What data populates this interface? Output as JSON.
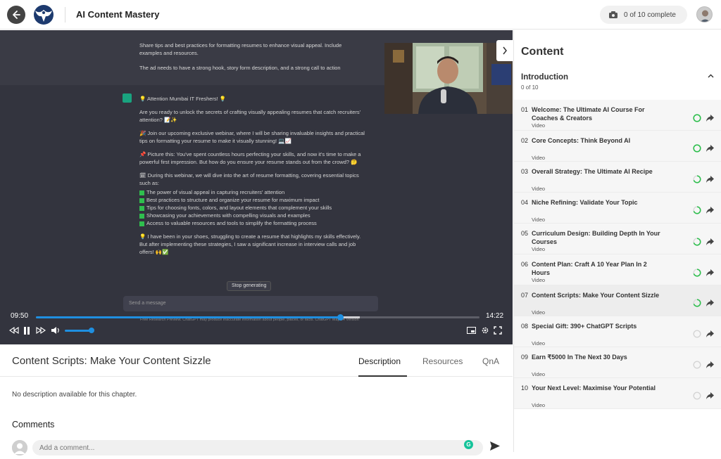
{
  "header": {
    "title": "AI Content Mastery",
    "progress_text": "0 of 10 complete"
  },
  "video": {
    "prompt_lines": [
      "Share tips and best practices for formatting resumes to enhance visual appeal. Include examples and resources.",
      "The ad needs to have a strong hook, story form description, and a strong call to action"
    ],
    "answer": {
      "p1": "💡 Attention Mumbai IT Freshers! 💡",
      "p2": "Are you ready to unlock the secrets of crafting visually appealing resumes that catch recruiters' attention? 📝✨",
      "p3": "🎉 Join our upcoming exclusive webinar, where I will be sharing invaluable insights and practical tips on formatting your resume to make it visually stunning! 💻📈",
      "p4": "📌 Picture this: You've spent countless hours perfecting your skills, and now it's time to make a powerful first impression. But how do you ensure your resume stands out from the crowd? 🤔",
      "p5": "🗓 During this webinar, we will dive into the art of resume formatting, covering essential topics such as:",
      "bullets": [
        "The power of visual appeal in capturing recruiters' attention",
        "Best practices to structure and organize your resume for maximum impact",
        "Tips for choosing fonts, colors, and layout elements that complement your skills",
        "Showcasing your achievements with compelling visuals and examples",
        "Access to valuable resources and tools to simplify the formatting process"
      ],
      "p6": "💡 I have been in your shoes, struggling to create a resume that highlights my skills effectively. But after implementing these strategies, I saw a significant increase in interview calls and job offers! 🙌✅"
    },
    "stop_generating": "Stop generating",
    "send_placeholder": "Send a message",
    "disclaimer": "Free Research Preview. ChatGPT may produce inaccurate information about people, places, or facts. ChatGPT May 24 Version",
    "current_time": "09:50",
    "total_time": "14:22",
    "progress": 0.685,
    "buffered": 0.73,
    "volume": 0.9
  },
  "chapter": {
    "title": "Content Scripts: Make Your Content Sizzle",
    "tabs": [
      "Description",
      "Resources",
      "QnA"
    ],
    "active_tab": "Description",
    "description": "No description available for this chapter."
  },
  "comments": {
    "title": "Comments",
    "placeholder": "Add a comment..."
  },
  "sidebar": {
    "title": "Content",
    "section": {
      "title": "Introduction",
      "count": "0 of 10"
    },
    "lessons": [
      {
        "num": "01",
        "title": "Welcome: The Ultimate AI Course For Coaches & Creators",
        "type": "Video",
        "status": "complete"
      },
      {
        "num": "02",
        "title": "Core Concepts: Think Beyond AI",
        "type": "Video",
        "status": "complete"
      },
      {
        "num": "03",
        "title": "Overall Strategy: The Ultimate AI Recipe",
        "type": "Video",
        "status": "partial"
      },
      {
        "num": "04",
        "title": "Niche Refining: Validate Your Topic",
        "type": "Video",
        "status": "partial"
      },
      {
        "num": "05",
        "title": "Curriculum Design: Building Depth In Your Courses",
        "type": "Video",
        "status": "partial"
      },
      {
        "num": "06",
        "title": "Content Plan: Craft A 10 Year Plan In 2 Hours",
        "type": "Video",
        "status": "partial"
      },
      {
        "num": "07",
        "title": "Content Scripts: Make Your Content Sizzle",
        "type": "Video",
        "status": "partial"
      },
      {
        "num": "08",
        "title": "Special Gift: 390+ ChatGPT Scripts",
        "type": "Video",
        "status": "none"
      },
      {
        "num": "09",
        "title": "Earn ₹5000 In The Next 30 Days",
        "type": "Video",
        "status": "none"
      },
      {
        "num": "10",
        "title": "Your Next Level: Maximise Your Potential",
        "type": "Video",
        "status": "none"
      }
    ]
  },
  "colors": {
    "accent_blue": "#1f8fe0",
    "complete_green": "#2fbf4e"
  }
}
